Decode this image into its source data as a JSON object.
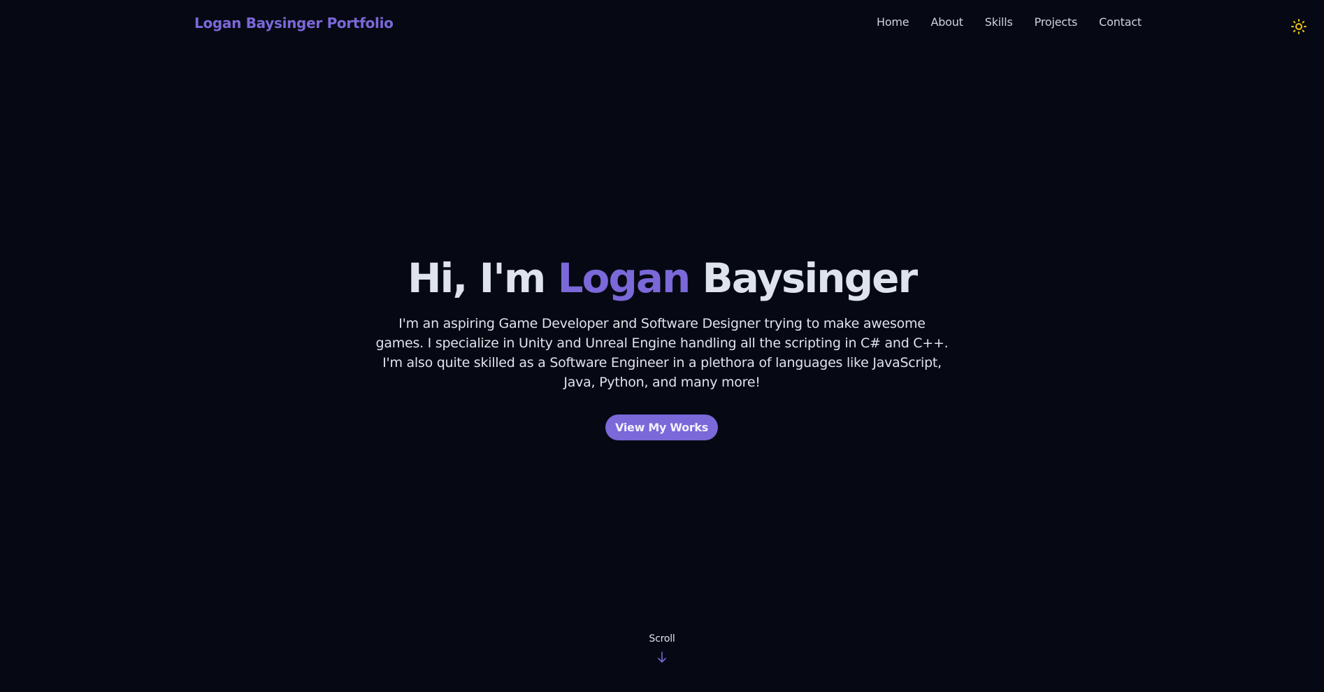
{
  "navbar": {
    "brand": "Logan Baysinger Portfolio",
    "links": [
      {
        "label": "Home"
      },
      {
        "label": "About"
      },
      {
        "label": "Skills"
      },
      {
        "label": "Projects"
      },
      {
        "label": "Contact"
      }
    ],
    "theme_toggle_icon": "sun-icon"
  },
  "hero": {
    "greeting": "Hi, I'm",
    "first_name": "Logan",
    "last_name": "Baysinger",
    "description": "I'm an aspiring Game Developer and Software Designer trying to make awesome games. I specialize in Unity and Unreal Engine handling all the scripting in C# and C++. I'm also quite skilled as a Software Engineer in a plethora of languages like JavaScript, Java, Python, and many more!",
    "cta_label": "View My Works"
  },
  "scroll": {
    "label": "Scroll",
    "icon": "arrow-down-icon"
  },
  "colors": {
    "background": "#060913",
    "accent": "#7b68d9",
    "text": "#dfe3ee",
    "sun": "#f5c518"
  }
}
